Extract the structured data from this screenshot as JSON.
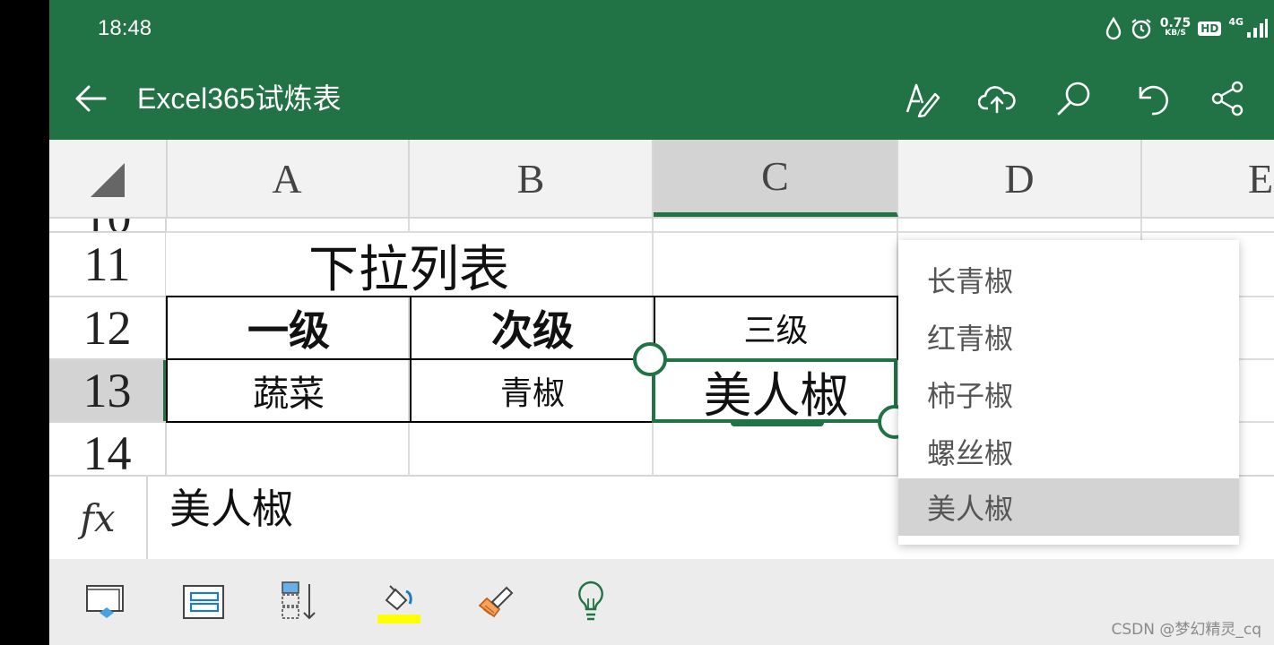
{
  "status_bar": {
    "time": "18:48",
    "net_speed_value": "0.75",
    "net_speed_unit": "KB/S",
    "hd_badge": "HD",
    "network_type": "4G"
  },
  "app_bar": {
    "title": "Excel365试炼表",
    "icons": [
      "back-arrow-icon",
      "draw-pen-icon",
      "cloud-upload-icon",
      "search-icon",
      "undo-icon",
      "share-icon"
    ]
  },
  "grid": {
    "columns": [
      "A",
      "B",
      "C",
      "D",
      "E"
    ],
    "selected_column": "C",
    "rows": [
      "10",
      "11",
      "12",
      "13",
      "14"
    ],
    "selected_row": "13",
    "cells": {
      "r11_title": "下拉列表",
      "r12_a": "一级",
      "r12_b": "次级",
      "r12_c": "三级",
      "r13_a": "蔬菜",
      "r13_b": "青椒",
      "r13_c": "美人椒"
    }
  },
  "formula_bar": {
    "label": "fx",
    "value": "美人椒"
  },
  "dropdown": {
    "items": [
      "长青椒",
      "红青椒",
      "柿子椒",
      "螺丝椒",
      "美人椒"
    ],
    "selected": "美人椒"
  },
  "bottom_toolbar": {
    "icons": [
      "freeze-panes-icon",
      "insert-rows-icon",
      "sort-icon",
      "fill-color-icon",
      "format-painter-icon",
      "tell-me-bulb-icon"
    ],
    "fill_color_accent": "#ffff00"
  },
  "watermark": "CSDN @梦幻精灵_cq",
  "colors": {
    "brand_green": "#217346",
    "selection_green": "#217346"
  }
}
